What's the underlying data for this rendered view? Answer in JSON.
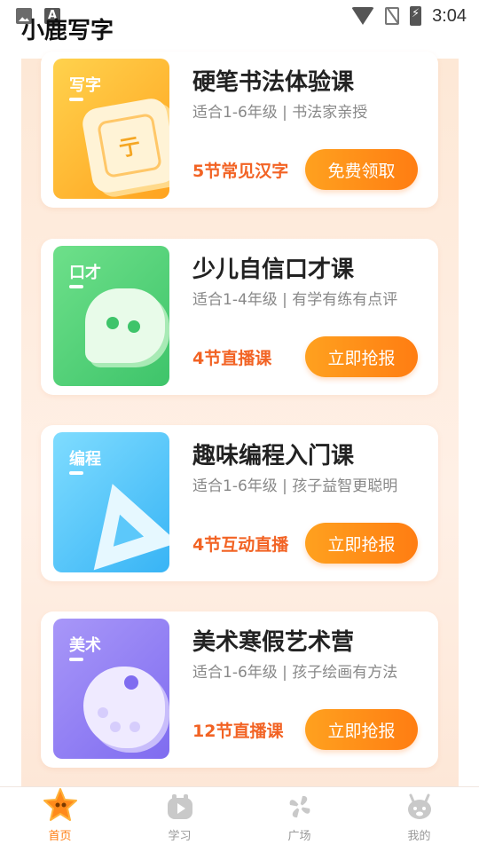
{
  "status_bar": {
    "time": "3:04"
  },
  "app": {
    "title": "小鹿写字"
  },
  "courses": [
    {
      "thumb_label": "写字",
      "title": "硬笔书法体验课",
      "subtitle": "适合1-6年级 | 书法家亲授",
      "note": "5节常见汉字",
      "button": "免费领取",
      "colors": [
        "#ffc53d",
        "#ffa31f"
      ]
    },
    {
      "thumb_label": "口才",
      "title": "少儿自信口才课",
      "subtitle": "适合1-4年级 | 有学有练有点评",
      "note": "4节直播课",
      "button": "立即抢报",
      "colors": [
        "#6ee08a",
        "#3ec46a"
      ]
    },
    {
      "thumb_label": "编程",
      "title": "趣味编程入门课",
      "subtitle": "适合1-6年级 | 孩子益智更聪明",
      "note": "4节互动直播",
      "button": "立即抢报",
      "colors": [
        "#6fd8ff",
        "#38b4f5"
      ]
    },
    {
      "thumb_label": "美术",
      "title": "美术寒假艺术营",
      "subtitle": "适合1-6年级 | 孩子绘画有方法",
      "note": "12节直播课",
      "button": "立即抢报",
      "colors": [
        "#a28cf7",
        "#7f6cf0"
      ]
    }
  ],
  "bottom_nav": [
    {
      "label": "首页",
      "icon": "home-star-icon",
      "active": true
    },
    {
      "label": "学习",
      "icon": "study-icon",
      "active": false
    },
    {
      "label": "广场",
      "icon": "square-icon",
      "active": false
    },
    {
      "label": "我的",
      "icon": "profile-icon",
      "active": false
    }
  ],
  "accent_color": "#ff7d12"
}
